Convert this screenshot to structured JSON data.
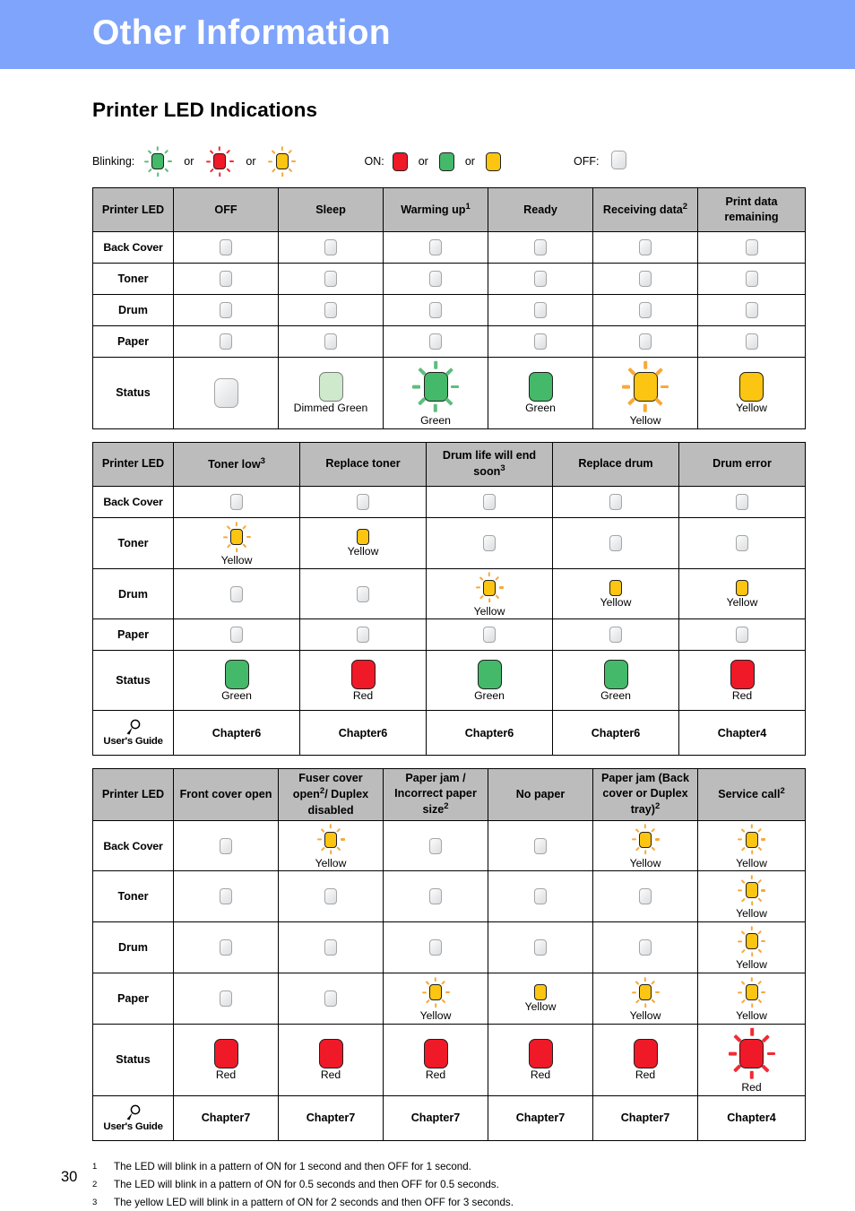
{
  "banner": {
    "title": "Other Information"
  },
  "section": {
    "title": "Printer LED Indications"
  },
  "legend": {
    "blinking_label": "Blinking:",
    "on_label": "ON:",
    "off_label": "OFF:",
    "or": "or",
    "blinking_colors": [
      "green",
      "red",
      "yellow"
    ],
    "on_colors": [
      "red",
      "green",
      "yellow"
    ],
    "colors": {
      "green": "#45b96a",
      "red": "#f01928",
      "yellow": "#fcc512",
      "dimmed_green": "#cfe9cc",
      "off": "#e7e9eb",
      "banner": "#7fa4fb",
      "header_fill": "#bcbcbc"
    }
  },
  "tables": [
    {
      "id": "table-1",
      "headers": [
        {
          "label": "Printer LED",
          "sup": ""
        },
        {
          "label": "OFF",
          "sup": ""
        },
        {
          "label": "Sleep",
          "sup": ""
        },
        {
          "label": "Warming up",
          "sup": "1"
        },
        {
          "label": "Ready",
          "sup": ""
        },
        {
          "label": "Receiving data",
          "sup": "2"
        },
        {
          "label": "Print data remaining",
          "sup": ""
        }
      ],
      "rows": [
        {
          "label": "Back Cover",
          "cells": [
            {
              "state": "off"
            },
            {
              "state": "off"
            },
            {
              "state": "off"
            },
            {
              "state": "off"
            },
            {
              "state": "off"
            },
            {
              "state": "off"
            }
          ]
        },
        {
          "label": "Toner",
          "cells": [
            {
              "state": "off"
            },
            {
              "state": "off"
            },
            {
              "state": "off"
            },
            {
              "state": "off"
            },
            {
              "state": "off"
            },
            {
              "state": "off"
            }
          ]
        },
        {
          "label": "Drum",
          "cells": [
            {
              "state": "off"
            },
            {
              "state": "off"
            },
            {
              "state": "off"
            },
            {
              "state": "off"
            },
            {
              "state": "off"
            },
            {
              "state": "off"
            }
          ]
        },
        {
          "label": "Paper",
          "cells": [
            {
              "state": "off"
            },
            {
              "state": "off"
            },
            {
              "state": "off"
            },
            {
              "state": "off"
            },
            {
              "state": "off"
            },
            {
              "state": "off"
            }
          ]
        },
        {
          "label": "Status",
          "type": "status",
          "cells": [
            {
              "state": "off",
              "caption": ""
            },
            {
              "state": "dimmed-green",
              "caption": "Dimmed Green"
            },
            {
              "state": "green",
              "blink": true,
              "caption": "Green"
            },
            {
              "state": "green",
              "caption": "Green"
            },
            {
              "state": "yellow",
              "blink": true,
              "caption": "Yellow"
            },
            {
              "state": "yellow",
              "caption": "Yellow"
            }
          ]
        }
      ]
    },
    {
      "id": "table-2",
      "headers": [
        {
          "label": "Printer LED",
          "sup": ""
        },
        {
          "label": "Toner low",
          "sup": "3"
        },
        {
          "label": "Replace toner",
          "sup": ""
        },
        {
          "label": "Drum life will end soon",
          "sup": "3"
        },
        {
          "label": "Replace drum",
          "sup": ""
        },
        {
          "label": "Drum error",
          "sup": ""
        }
      ],
      "rows": [
        {
          "label": "Back Cover",
          "cells": [
            {
              "state": "off"
            },
            {
              "state": "off"
            },
            {
              "state": "off"
            },
            {
              "state": "off"
            },
            {
              "state": "off"
            }
          ]
        },
        {
          "label": "Toner",
          "cells": [
            {
              "state": "yellow",
              "blink": true,
              "caption": "Yellow"
            },
            {
              "state": "yellow",
              "caption": "Yellow"
            },
            {
              "state": "off"
            },
            {
              "state": "off"
            },
            {
              "state": "off"
            }
          ]
        },
        {
          "label": "Drum",
          "cells": [
            {
              "state": "off"
            },
            {
              "state": "off"
            },
            {
              "state": "yellow",
              "blink": true,
              "caption": "Yellow"
            },
            {
              "state": "yellow",
              "caption": "Yellow"
            },
            {
              "state": "yellow",
              "caption": "Yellow"
            }
          ]
        },
        {
          "label": "Paper",
          "cells": [
            {
              "state": "off"
            },
            {
              "state": "off"
            },
            {
              "state": "off"
            },
            {
              "state": "off"
            },
            {
              "state": "off"
            }
          ]
        },
        {
          "label": "Status",
          "type": "status",
          "cells": [
            {
              "state": "green",
              "caption": "Green"
            },
            {
              "state": "red",
              "caption": "Red"
            },
            {
              "state": "green",
              "caption": "Green"
            },
            {
              "state": "green",
              "caption": "Green"
            },
            {
              "state": "red",
              "caption": "Red"
            }
          ]
        },
        {
          "label": "User's Guide",
          "type": "guide",
          "cells": [
            {
              "text": "Chapter6"
            },
            {
              "text": "Chapter6"
            },
            {
              "text": "Chapter6"
            },
            {
              "text": "Chapter6"
            },
            {
              "text": "Chapter4"
            }
          ]
        }
      ]
    },
    {
      "id": "table-3",
      "headers": [
        {
          "label": "Printer LED",
          "sup": ""
        },
        {
          "label": "Front cover open",
          "sup": ""
        },
        {
          "label": "Fuser cover open",
          "sup": "2",
          "tail": "/ Duplex disabled"
        },
        {
          "label": "Paper jam / Incorrect paper size",
          "sup": "2"
        },
        {
          "label": "No paper",
          "sup": ""
        },
        {
          "label": "Paper jam (Back cover or Duplex tray)",
          "sup": "2"
        },
        {
          "label": "Service call",
          "sup": "2"
        }
      ],
      "rows": [
        {
          "label": "Back Cover",
          "cells": [
            {
              "state": "off"
            },
            {
              "state": "yellow",
              "blink": true,
              "caption": "Yellow"
            },
            {
              "state": "off"
            },
            {
              "state": "off"
            },
            {
              "state": "yellow",
              "blink": true,
              "caption": "Yellow"
            },
            {
              "state": "yellow",
              "blink": true,
              "caption": "Yellow"
            }
          ]
        },
        {
          "label": "Toner",
          "cells": [
            {
              "state": "off"
            },
            {
              "state": "off"
            },
            {
              "state": "off"
            },
            {
              "state": "off"
            },
            {
              "state": "off"
            },
            {
              "state": "yellow",
              "blink": true,
              "caption": "Yellow"
            }
          ]
        },
        {
          "label": "Drum",
          "cells": [
            {
              "state": "off"
            },
            {
              "state": "off"
            },
            {
              "state": "off"
            },
            {
              "state": "off"
            },
            {
              "state": "off"
            },
            {
              "state": "yellow",
              "blink": true,
              "caption": "Yellow"
            }
          ]
        },
        {
          "label": "Paper",
          "cells": [
            {
              "state": "off"
            },
            {
              "state": "off"
            },
            {
              "state": "yellow",
              "blink": true,
              "caption": "Yellow"
            },
            {
              "state": "yellow",
              "caption": "Yellow"
            },
            {
              "state": "yellow",
              "blink": true,
              "caption": "Yellow"
            },
            {
              "state": "yellow",
              "blink": true,
              "caption": "Yellow"
            }
          ]
        },
        {
          "label": "Status",
          "type": "status",
          "cells": [
            {
              "state": "red",
              "caption": "Red"
            },
            {
              "state": "red",
              "caption": "Red"
            },
            {
              "state": "red",
              "caption": "Red"
            },
            {
              "state": "red",
              "caption": "Red"
            },
            {
              "state": "red",
              "caption": "Red"
            },
            {
              "state": "red",
              "blink": true,
              "caption": "Red"
            }
          ]
        },
        {
          "label": "User's Guide",
          "type": "guide",
          "cells": [
            {
              "text": "Chapter7"
            },
            {
              "text": "Chapter7"
            },
            {
              "text": "Chapter7"
            },
            {
              "text": "Chapter7"
            },
            {
              "text": "Chapter7"
            },
            {
              "text": "Chapter4"
            }
          ]
        }
      ]
    }
  ],
  "footnotes": [
    {
      "num": "1",
      "text": "The LED will blink in a pattern of ON for 1 second and then OFF for 1 second."
    },
    {
      "num": "2",
      "text": "The LED will blink in a pattern of ON for 0.5 seconds and then OFF for 0.5 seconds."
    },
    {
      "num": "3",
      "text": "The yellow LED will blink in a pattern of ON for 2 seconds and then OFF for 3 seconds."
    }
  ],
  "page_number": "30"
}
